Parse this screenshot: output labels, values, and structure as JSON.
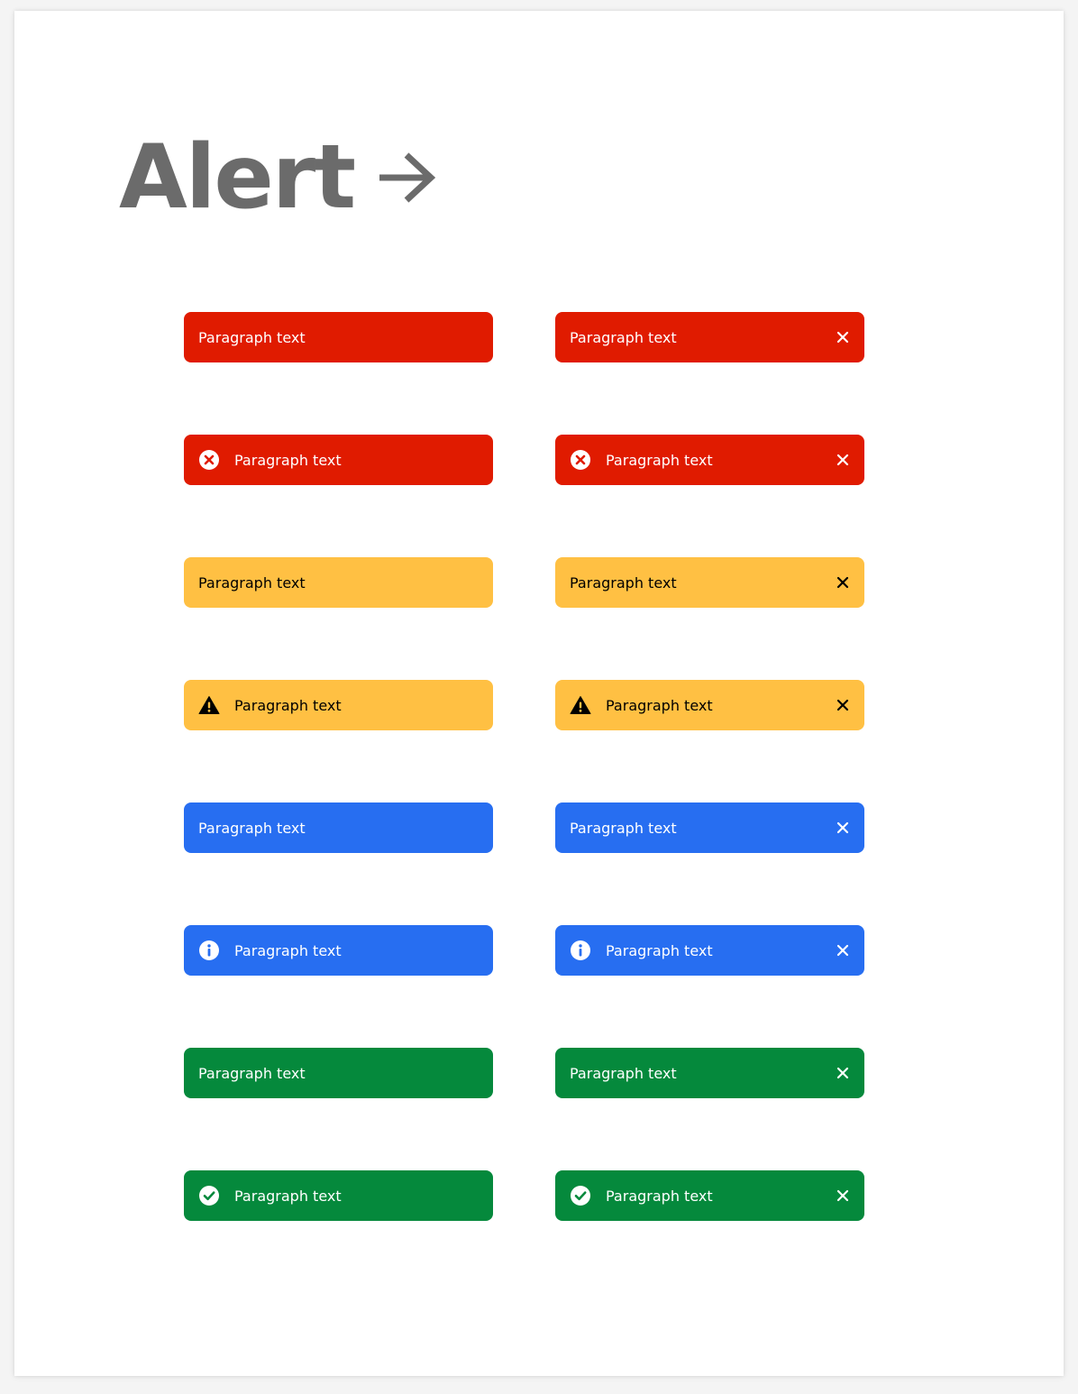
{
  "page": {
    "title": "Alert",
    "title_arrow_icon": "arrow-right-icon",
    "title_color": "#6b6b6b"
  },
  "colors": {
    "error": "#e01b00",
    "warning": "#ffc043",
    "info": "#276ef1",
    "success": "#05893c"
  },
  "alerts": [
    {
      "kind": "error",
      "icon": null,
      "text": "Paragraph text",
      "dismissible": false
    },
    {
      "kind": "error",
      "icon": null,
      "text": "Paragraph text",
      "dismissible": true
    },
    {
      "kind": "error",
      "icon": "x-circle-icon",
      "text": "Paragraph text",
      "dismissible": false
    },
    {
      "kind": "error",
      "icon": "x-circle-icon",
      "text": "Paragraph text",
      "dismissible": true
    },
    {
      "kind": "warning",
      "icon": null,
      "text": "Paragraph text",
      "dismissible": false
    },
    {
      "kind": "warning",
      "icon": null,
      "text": "Paragraph text",
      "dismissible": true
    },
    {
      "kind": "warning",
      "icon": "warning-triangle-icon",
      "text": "Paragraph text",
      "dismissible": false
    },
    {
      "kind": "warning",
      "icon": "warning-triangle-icon",
      "text": "Paragraph text",
      "dismissible": true
    },
    {
      "kind": "info",
      "icon": null,
      "text": "Paragraph text",
      "dismissible": false
    },
    {
      "kind": "info",
      "icon": null,
      "text": "Paragraph text",
      "dismissible": true
    },
    {
      "kind": "info",
      "icon": "info-circle-icon",
      "text": "Paragraph text",
      "dismissible": false
    },
    {
      "kind": "info",
      "icon": "info-circle-icon",
      "text": "Paragraph text",
      "dismissible": true
    },
    {
      "kind": "success",
      "icon": null,
      "text": "Paragraph text",
      "dismissible": false
    },
    {
      "kind": "success",
      "icon": null,
      "text": "Paragraph text",
      "dismissible": true
    },
    {
      "kind": "success",
      "icon": "check-circle-icon",
      "text": "Paragraph text",
      "dismissible": false
    },
    {
      "kind": "success",
      "icon": "check-circle-icon",
      "text": "Paragraph text",
      "dismissible": true
    }
  ],
  "close_icon": "close-icon"
}
